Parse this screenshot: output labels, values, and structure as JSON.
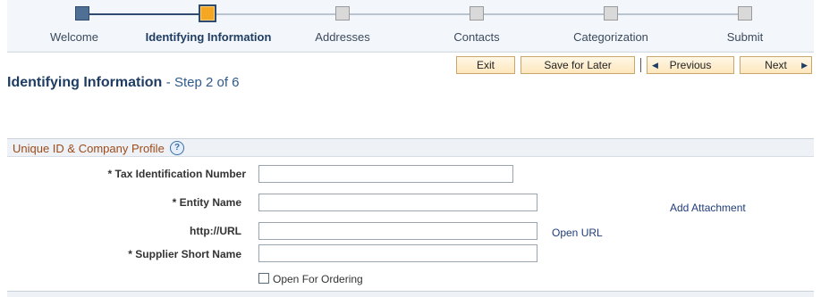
{
  "train": {
    "steps": [
      {
        "label": "Welcome",
        "state": "done"
      },
      {
        "label": "Identifying Information",
        "state": "current"
      },
      {
        "label": "Addresses",
        "state": "todo"
      },
      {
        "label": "Contacts",
        "state": "todo"
      },
      {
        "label": "Categorization",
        "state": "todo"
      },
      {
        "label": "Submit",
        "state": "todo"
      }
    ],
    "colors": {
      "done": "#4f6f95",
      "current": "#f5a623",
      "todo": "#d9d9d9"
    }
  },
  "toolbar": {
    "exit_label": "Exit",
    "save_label": "Save for Later",
    "previous_label": "Previous",
    "next_label": "Next",
    "previous_icon": "triangle-left-icon",
    "next_icon": "triangle-right-icon"
  },
  "page": {
    "title": "Identifying Information",
    "step_text": "- Step 2 of 6"
  },
  "section": {
    "title": "Unique ID & Company Profile",
    "help_glyph": "?"
  },
  "form": {
    "tax_id": {
      "label": "* Tax Identification Number",
      "value": ""
    },
    "entity_name": {
      "label": "* Entity Name",
      "value": ""
    },
    "url": {
      "label": "http://URL",
      "value": ""
    },
    "short_name": {
      "label": "* Supplier Short Name",
      "value": ""
    },
    "open_for_ordering": {
      "label": "Open For Ordering",
      "checked": false
    }
  },
  "links": {
    "add_attachment": "Add Attachment",
    "open_url": "Open URL"
  },
  "colors": {
    "brand": "#1f3d63",
    "section_title": "#9c4a1a",
    "button_bg": "#fde7bd"
  }
}
